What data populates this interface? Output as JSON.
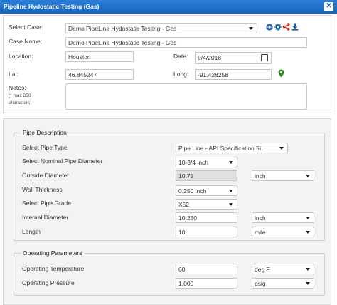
{
  "window": {
    "title": "Pipeline Hydostatic Testing (Gas)"
  },
  "case": {
    "select_case_label": "Select Case:",
    "select_case_value": "Demo PipeLine Hydostatic Testing - Gas",
    "case_name_label": "Case Name:",
    "case_name_value": "Demo  PipeLine Hydostatic Testing - Gas",
    "location_label": "Location:",
    "location_value": "Houston",
    "date_label": "Date:",
    "date_value": "9/4/2018",
    "lat_label": "Lat:",
    "lat_value": "46.845247",
    "long_label": "Long:",
    "long_value": "-91.428258",
    "notes_label": "Notes:",
    "notes_hint": "(* max 850 characters)",
    "notes_value": ""
  },
  "pipe": {
    "legend": "Pipe Description",
    "pipe_type_label": "Select Pipe Type",
    "pipe_type_value": "Pipe Line - API Specification 5L",
    "nominal_label": "Select Nominal Pipe Diameter",
    "nominal_value": "10-3/4 inch",
    "od_label": "Outside Diameter",
    "od_value": "10.75",
    "od_unit": "inch",
    "wall_label": "Wall Thickness",
    "wall_value": "0.250 inch",
    "grade_label": "Select Pipe Grade",
    "grade_value": "X52",
    "id_label": "Internal Diameter",
    "id_value": "10.250",
    "id_unit": "inch",
    "length_label": "Length",
    "length_value": "10",
    "length_unit": "mile"
  },
  "operating": {
    "legend": "Operating Parameters",
    "temp_label": "Operating Temperature",
    "temp_value": "60",
    "temp_unit": "deg F",
    "pressure_label": "Operating Pressure",
    "pressure_value": "1,000",
    "pressure_unit": "psig"
  },
  "colors": {
    "titlebar": "#1565c0",
    "map_pin": "#2e8b22",
    "share_icon": "#d9342b",
    "action_icons": "#1f5fa8"
  },
  "icons": [
    "close-icon",
    "add-icon",
    "settings-icon",
    "share-icon",
    "download-icon",
    "calendar-icon",
    "map-pin-icon"
  ]
}
